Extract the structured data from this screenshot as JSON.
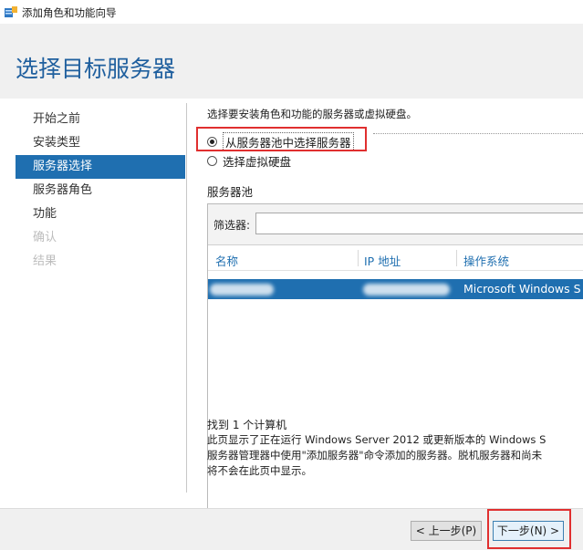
{
  "window": {
    "title": "添加角色和功能向导",
    "icon": "server-manager-icon"
  },
  "page_title": "选择目标服务器",
  "nav": {
    "items": [
      {
        "label": "开始之前",
        "state": "normal"
      },
      {
        "label": "安装类型",
        "state": "normal"
      },
      {
        "label": "服务器选择",
        "state": "active"
      },
      {
        "label": "服务器角色",
        "state": "normal"
      },
      {
        "label": "功能",
        "state": "normal"
      },
      {
        "label": "确认",
        "state": "disabled"
      },
      {
        "label": "结果",
        "state": "disabled"
      }
    ]
  },
  "main": {
    "description": "选择要安装角色和功能的服务器或虚拟硬盘。",
    "options": [
      {
        "label": "从服务器池中选择服务器",
        "selected": true
      },
      {
        "label": "选择虚拟硬盘",
        "selected": false
      }
    ],
    "pool_label": "服务器池",
    "filter_label": "筛选器:",
    "filter_value": "",
    "columns": [
      "名称",
      "IP 地址",
      "操作系统"
    ],
    "rows": [
      {
        "name": "",
        "ip": "",
        "os": "Microsoft Windows S",
        "selected": true
      }
    ],
    "found_text": "找到 1 个计算机",
    "info_lines": [
      "此页显示了正在运行 Windows Server 2012 或更新版本的 Windows S",
      "服务器管理器中使用\"添加服务器\"命令添加的服务器。脱机服务器和尚未",
      "将不会在此页中显示。"
    ]
  },
  "footer": {
    "prev_label": "< 上一步(P)",
    "next_label": "下一步(N) >"
  },
  "colors": {
    "accent": "#1f6fb0",
    "title": "#1f5f9e",
    "highlight_box": "#e02f2f"
  }
}
